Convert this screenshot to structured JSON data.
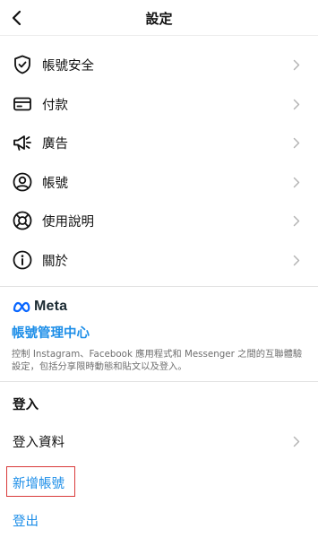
{
  "header": {
    "title": "設定",
    "back_icon": "chevron-left-icon"
  },
  "menu": [
    {
      "label": "帳號安全",
      "icon": "shield-check-icon"
    },
    {
      "label": "付款",
      "icon": "credit-card-icon"
    },
    {
      "label": "廣告",
      "icon": "megaphone-icon"
    },
    {
      "label": "帳號",
      "icon": "user-circle-icon"
    },
    {
      "label": "使用說明",
      "icon": "lifebuoy-icon"
    },
    {
      "label": "關於",
      "icon": "info-icon"
    }
  ],
  "meta": {
    "logo_text": "Meta",
    "accounts_center": "帳號管理中心",
    "description": "控制 Instagram、Facebook 應用程式和 Messenger 之間的互聯體驗設定，包括分享限時動態和貼文以及登入。"
  },
  "login_section": {
    "title": "登入",
    "login_info": "登入資料",
    "add_account": "新增帳號",
    "logout": "登出"
  },
  "colors": {
    "link": "#1d8ee8",
    "highlight_box": "#d93a3a",
    "meta_blue": "#0866ff"
  }
}
